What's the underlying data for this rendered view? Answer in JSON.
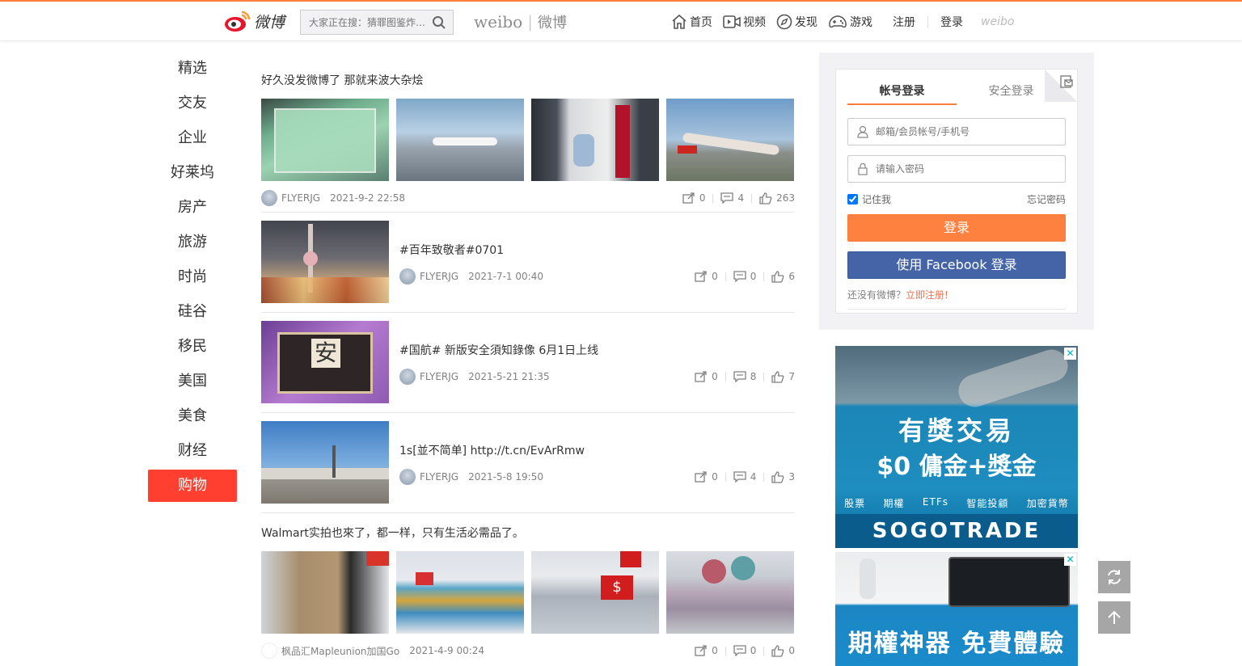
{
  "header": {
    "logo_text": "微博",
    "search_placeholder": "大家正在搜：猜罪图鉴炸…",
    "brand_en": "weibo",
    "brand_cn": "微博",
    "nav": [
      {
        "label": "首页",
        "icon": "home-icon"
      },
      {
        "label": "视频",
        "icon": "video-icon"
      },
      {
        "label": "发现",
        "icon": "discover-icon"
      },
      {
        "label": "游戏",
        "icon": "game-icon"
      }
    ],
    "register": "注册",
    "login": "登录",
    "small_logo": "weibo"
  },
  "categories": [
    "精选",
    "交友",
    "企业",
    "好莱坞",
    "房产",
    "旅游",
    "时尚",
    "硅谷",
    "移民",
    "美国",
    "美食",
    "财经",
    "购物"
  ],
  "active_category": "购物",
  "posts": [
    {
      "text": "好久没发微博了 那就来波大杂烩",
      "author": "FLYERJG",
      "date": "2021-9-2 22:58",
      "forward": "0",
      "comment": "4",
      "like": "263"
    },
    {
      "text": "#百年致敬者#0701",
      "author": "FLYERJG",
      "date": "2021-7-1 00:40",
      "forward": "0",
      "comment": "0",
      "like": "6"
    },
    {
      "text": "#国航# 新版安全須知錄像 6月1日上线",
      "author": "FLYERJG",
      "date": "2021-5-21 21:35",
      "forward": "0",
      "comment": "8",
      "like": "7"
    },
    {
      "text": "1s[並不简单] http://t.cn/EvArRmw",
      "author": "FLYERJG",
      "date": "2021-5-8 19:50",
      "forward": "0",
      "comment": "4",
      "like": "3"
    },
    {
      "text": "Walmart实拍也來了，都一样，只有生活必需品了。",
      "author": "枫品汇Mapleunion加国Go",
      "date": "2021-4-9 00:24",
      "forward": "0",
      "comment": "0",
      "like": "0"
    }
  ],
  "login": {
    "tab_account": "帐号登录",
    "tab_secure": "安全登录",
    "username_placeholder": "邮箱/会员帐号/手机号",
    "password_placeholder": "请输入密码",
    "remember": "记住我",
    "forgot": "忘记密码",
    "login_button": "登录",
    "facebook_button": "使用 Facebook 登录",
    "no_account": "还没有微博？",
    "register_link": "立即注册!"
  },
  "ads": {
    "ad1_line1": "有獎交易",
    "ad1_line2": "$0 傭金+獎金",
    "ad1_cats": [
      "股票",
      "期權",
      "ETFs",
      "智能投顧",
      "加密貨幣"
    ],
    "ad1_brand": "SOGOTRADE",
    "ad2_line": "期權神器 免費體驗",
    "close": "✕"
  },
  "colors": {
    "accent": "#fa7d3c",
    "active_tab": "#ff3f2f",
    "login_button": "#ff8140",
    "facebook_button": "#4564a8",
    "register_link": "#eb7350"
  }
}
